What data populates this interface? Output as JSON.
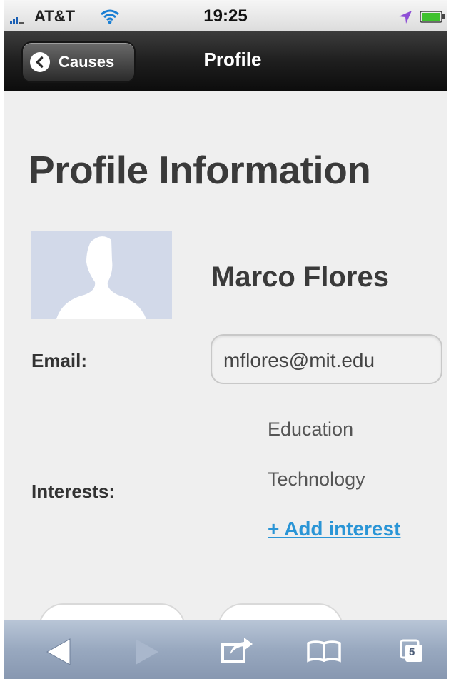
{
  "status_bar": {
    "carrier": "AT&T",
    "time": "19:25"
  },
  "nav_bar": {
    "back_label": "Causes",
    "title": "Profile"
  },
  "page": {
    "title": "Profile Information",
    "user_name": "Marco Flores",
    "email_label": "Email:",
    "email_value": "mflores@mit.edu",
    "interests_label": "Interests:",
    "interests": [
      "Education",
      "Technology"
    ],
    "add_interest_label": "+ Add interest"
  },
  "toolbar": {
    "tab_count": "5"
  },
  "colors": {
    "link": "#2a95d6",
    "nav_bar": "#1e1e1e",
    "avatar_bg": "#d2d9e9"
  }
}
